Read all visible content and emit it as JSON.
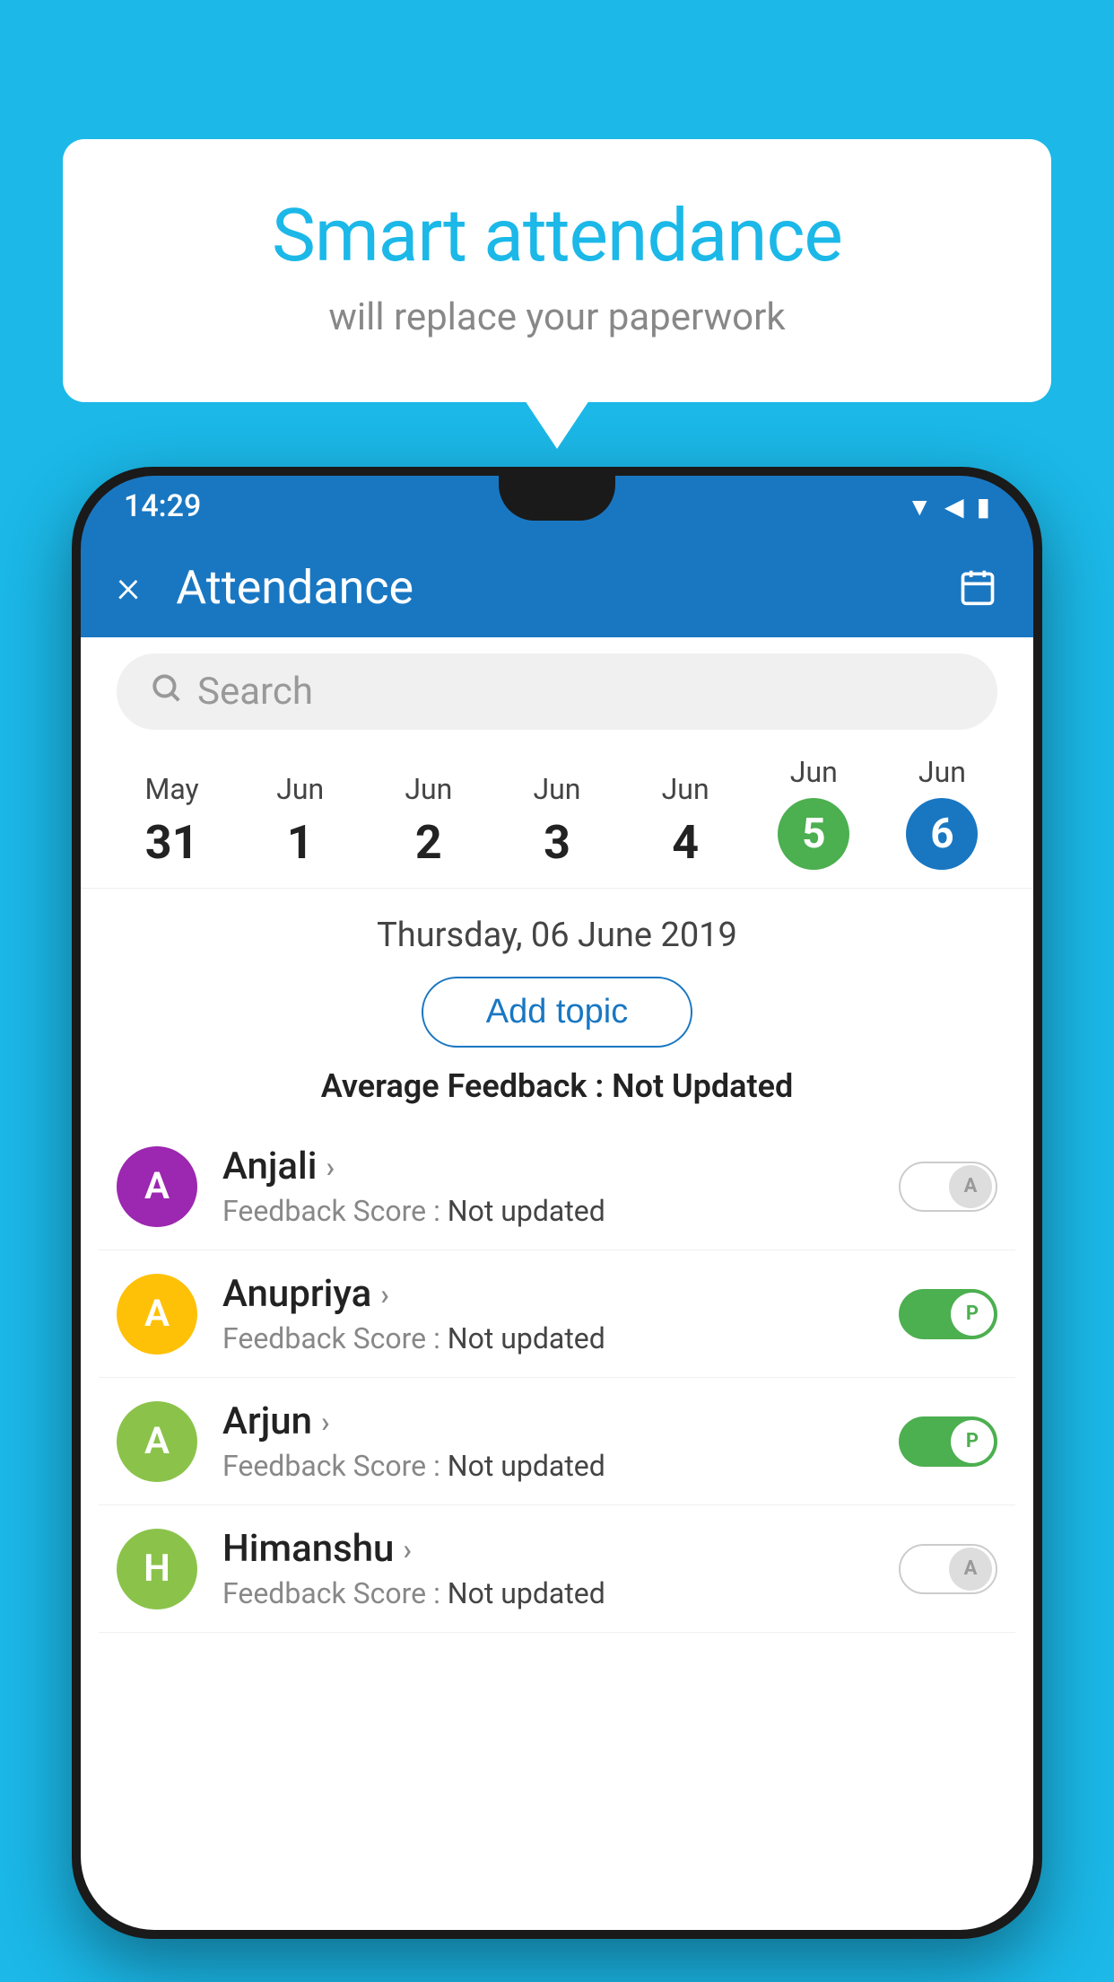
{
  "background_color": "#1BB8E8",
  "bubble": {
    "title": "Smart attendance",
    "subtitle": "will replace your paperwork"
  },
  "status_bar": {
    "time": "14:29",
    "icons": [
      "wifi",
      "signal",
      "battery"
    ]
  },
  "app_bar": {
    "title": "Attendance",
    "close_label": "×",
    "calendar_icon": "calendar"
  },
  "search": {
    "placeholder": "Search"
  },
  "dates": [
    {
      "month": "May",
      "day": "31",
      "state": "normal"
    },
    {
      "month": "Jun",
      "day": "1",
      "state": "normal"
    },
    {
      "month": "Jun",
      "day": "2",
      "state": "normal"
    },
    {
      "month": "Jun",
      "day": "3",
      "state": "normal"
    },
    {
      "month": "Jun",
      "day": "4",
      "state": "normal"
    },
    {
      "month": "Jun",
      "day": "5",
      "state": "today"
    },
    {
      "month": "Jun",
      "day": "6",
      "state": "selected"
    }
  ],
  "selected_date_label": "Thursday, 06 June 2019",
  "add_topic_label": "Add topic",
  "avg_feedback_label": "Average Feedback : ",
  "avg_feedback_value": "Not Updated",
  "students": [
    {
      "name": "Anjali",
      "avatar_letter": "A",
      "avatar_color": "#9C27B0",
      "feedback_label": "Feedback Score : ",
      "feedback_value": "Not updated",
      "toggle": "off",
      "toggle_letter": "A"
    },
    {
      "name": "Anupriya",
      "avatar_letter": "A",
      "avatar_color": "#FFC107",
      "feedback_label": "Feedback Score : ",
      "feedback_value": "Not updated",
      "toggle": "on",
      "toggle_letter": "P"
    },
    {
      "name": "Arjun",
      "avatar_letter": "A",
      "avatar_color": "#8BC34A",
      "feedback_label": "Feedback Score : ",
      "feedback_value": "Not updated",
      "toggle": "on",
      "toggle_letter": "P"
    },
    {
      "name": "Himanshu",
      "avatar_letter": "H",
      "avatar_color": "#8BC34A",
      "feedback_label": "Feedback Score : ",
      "feedback_value": "Not updated",
      "toggle": "off",
      "toggle_letter": "A"
    }
  ]
}
